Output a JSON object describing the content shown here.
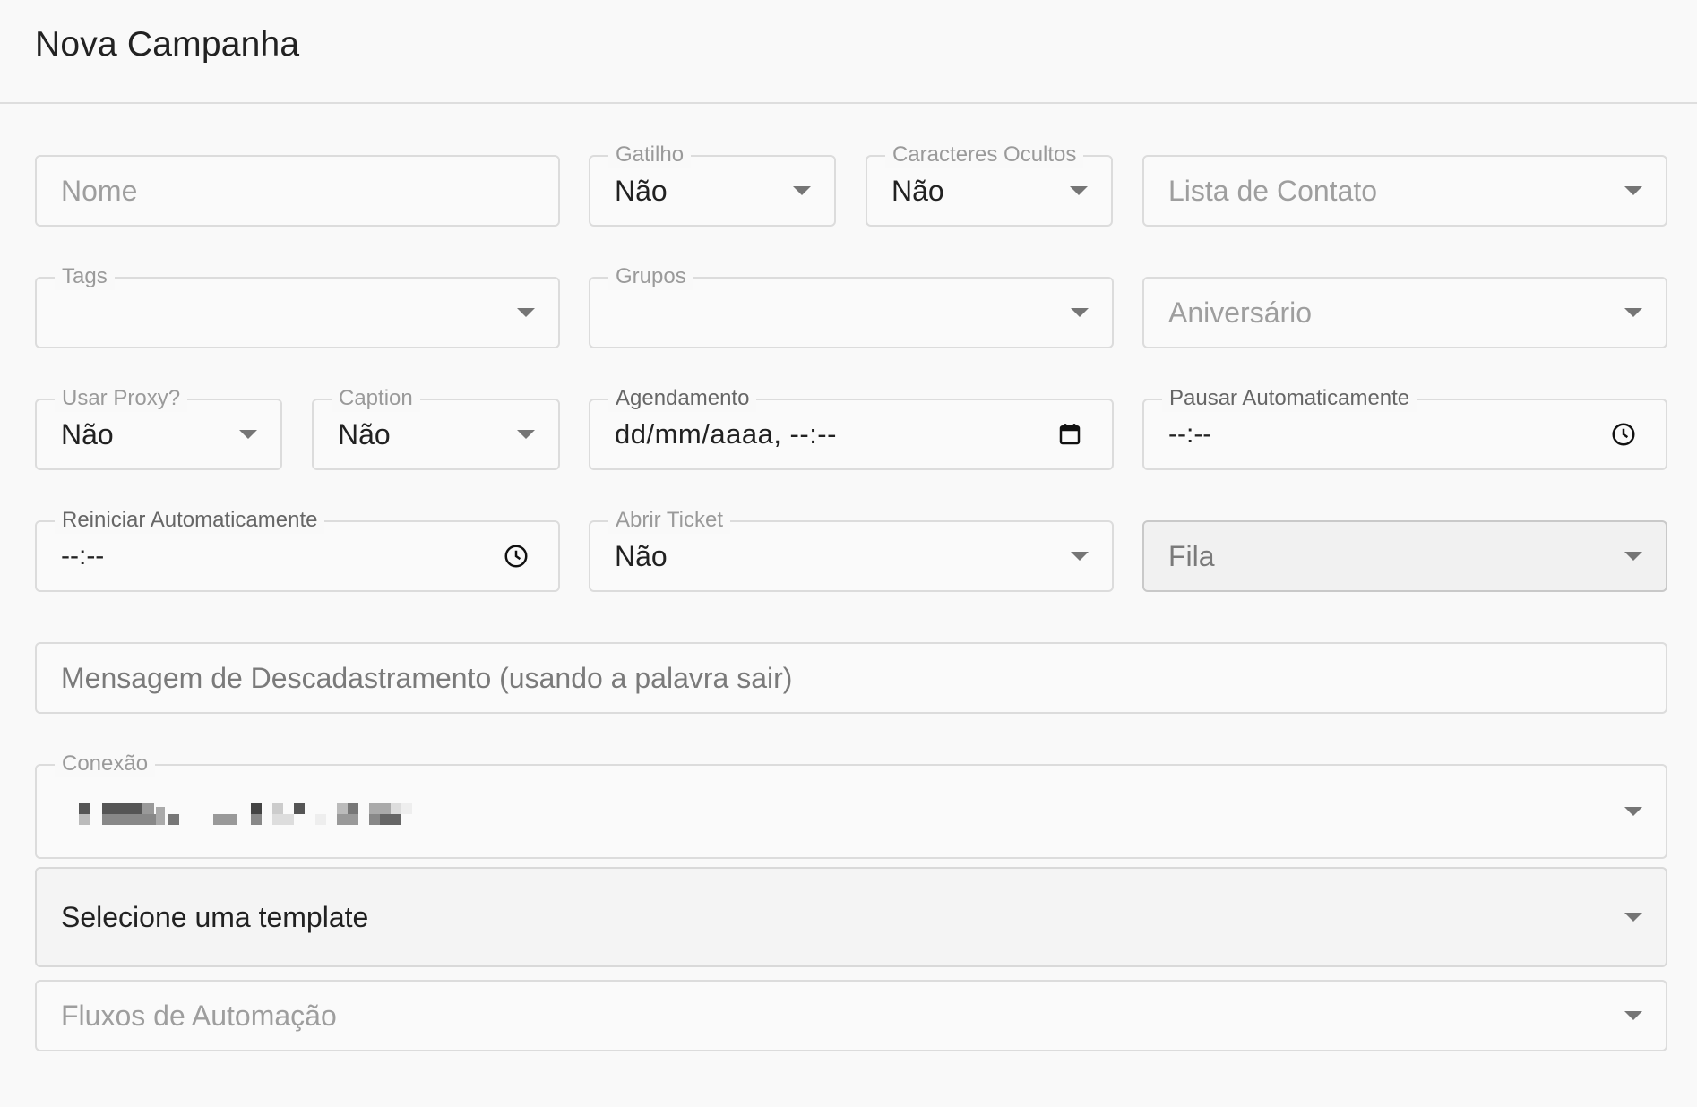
{
  "header": {
    "title": "Nova Campanha"
  },
  "fields": {
    "nome": {
      "placeholder": "Nome"
    },
    "gatilho": {
      "label": "Gatilho",
      "value": "Não"
    },
    "caracteres_ocultos": {
      "label": "Caracteres Ocultos",
      "value": "Não"
    },
    "lista_contato": {
      "placeholder": "Lista de Contato"
    },
    "tags": {
      "label": "Tags",
      "value": ""
    },
    "grupos": {
      "label": "Grupos",
      "value": ""
    },
    "aniversario": {
      "placeholder": "Aniversário"
    },
    "usar_proxy": {
      "label": "Usar Proxy?",
      "value": "Não"
    },
    "caption": {
      "label": "Caption",
      "value": "Não"
    },
    "agendamento": {
      "label": "Agendamento",
      "value": "dd/mm/aaaa, --:--"
    },
    "pausar": {
      "label": "Pausar Automaticamente",
      "value": "--:--"
    },
    "reiniciar": {
      "label": "Reiniciar Automaticamente",
      "value": "--:--"
    },
    "abrir_ticket": {
      "label": "Abrir Ticket",
      "value": "Não"
    },
    "fila": {
      "placeholder": "Fila"
    },
    "mensagem_descadastro": {
      "placeholder": "Mensagem de Descadastramento (usando a palavra sair)"
    },
    "conexao": {
      "label": "Conexão",
      "value": ""
    },
    "template": {
      "value": "Selecione uma template"
    },
    "fluxos": {
      "placeholder": "Fluxos de Automação"
    }
  },
  "icons": {
    "dropdown": "chevron-down-icon",
    "calendar": "calendar-icon",
    "clock": "clock-icon"
  },
  "colors": {
    "background": "#f9f9f9",
    "border": "#dcdcdc",
    "label": "#9a9a9a"
  }
}
